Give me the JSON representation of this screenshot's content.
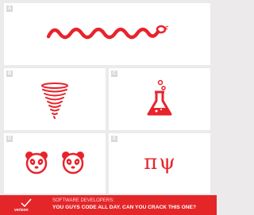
{
  "panels": {
    "a": {
      "tag": "A",
      "icon": "snake-icon"
    },
    "b": {
      "tag": "B",
      "icon": "tornado-icon"
    },
    "c": {
      "tag": "C",
      "icon": "flask-icon"
    },
    "d": {
      "tag": "D",
      "icon": "panda-face-icon"
    },
    "e": {
      "tag": "E",
      "symbols": "πψ"
    }
  },
  "banner": {
    "logo_text": "verizon",
    "subtitle": "SOFTWARE DEVELOPERS:",
    "headline": "YOU GUYS CODE ALL DAY. CAN YOU CRACK THIS ONE?"
  },
  "colors": {
    "accent": "#e8232c",
    "banner": "#e42629",
    "background": "#eceaea",
    "panel": "#ffffff",
    "tag": "#d9d9d9"
  }
}
